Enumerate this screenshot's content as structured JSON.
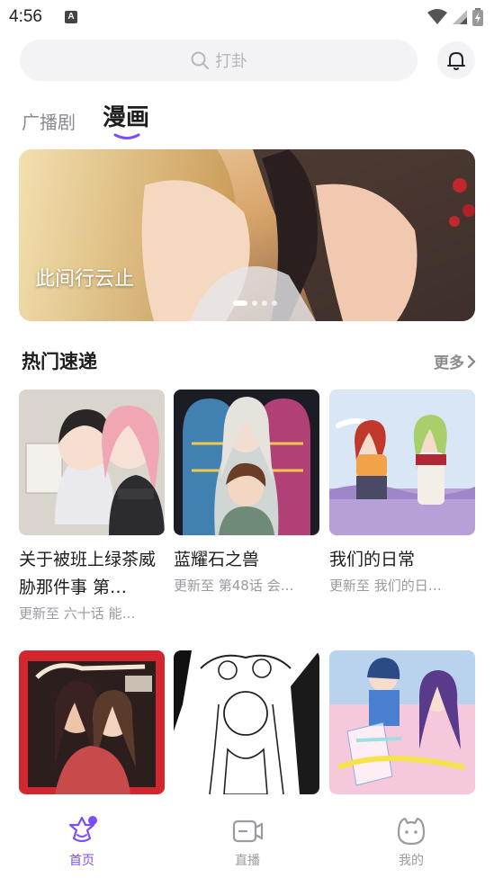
{
  "status": {
    "time": "4:56",
    "notif_badge": "A"
  },
  "search": {
    "placeholder": "打卦"
  },
  "tabs": [
    {
      "label": "广播剧",
      "active": false
    },
    {
      "label": "漫画",
      "active": true
    }
  ],
  "banner": {
    "title": "此间行云止",
    "dots": 4,
    "active_dot": 0
  },
  "hot": {
    "title": "热门速递",
    "more": "更多",
    "items": [
      {
        "title": "关于被班上绿茶威胁那件事 第…",
        "subtitle": "更新至 六十话 能…"
      },
      {
        "title": "蓝耀石之兽",
        "subtitle": "更新至 第48话 会…"
      },
      {
        "title": "我们的日常",
        "subtitle": "更新至 我们的日…"
      }
    ]
  },
  "nav": [
    {
      "label": "首页",
      "icon": "home-star-icon",
      "active": true
    },
    {
      "label": "直播",
      "icon": "live-video-icon",
      "active": false
    },
    {
      "label": "我的",
      "icon": "profile-face-icon",
      "active": false
    }
  ],
  "colors": {
    "accent": "#7c4dff",
    "muted": "#9a9aa0",
    "search_bg": "#f3f3f5"
  }
}
